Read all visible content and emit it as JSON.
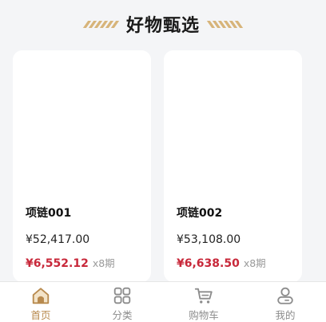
{
  "section": {
    "title": "好物甄选"
  },
  "products": [
    {
      "name": "项链001",
      "price": "¥52,417.00",
      "installment": "¥6,552.12",
      "period": "x8期"
    },
    {
      "name": "项链002",
      "price": "¥53,108.00",
      "installment": "¥6,638.50",
      "period": "x8期"
    }
  ],
  "tabbar": {
    "active": "home",
    "tabs": [
      {
        "key": "home",
        "label": "首页",
        "icon": "home-icon"
      },
      {
        "key": "category",
        "label": "分类",
        "icon": "category-icon"
      },
      {
        "key": "cart",
        "label": "购物车",
        "icon": "cart-icon"
      },
      {
        "key": "mine",
        "label": "我的",
        "icon": "profile-icon"
      }
    ]
  },
  "colors": {
    "accent_gold": "#b88a4e",
    "price_red": "#c8283a",
    "background": "#f4f5f7"
  }
}
